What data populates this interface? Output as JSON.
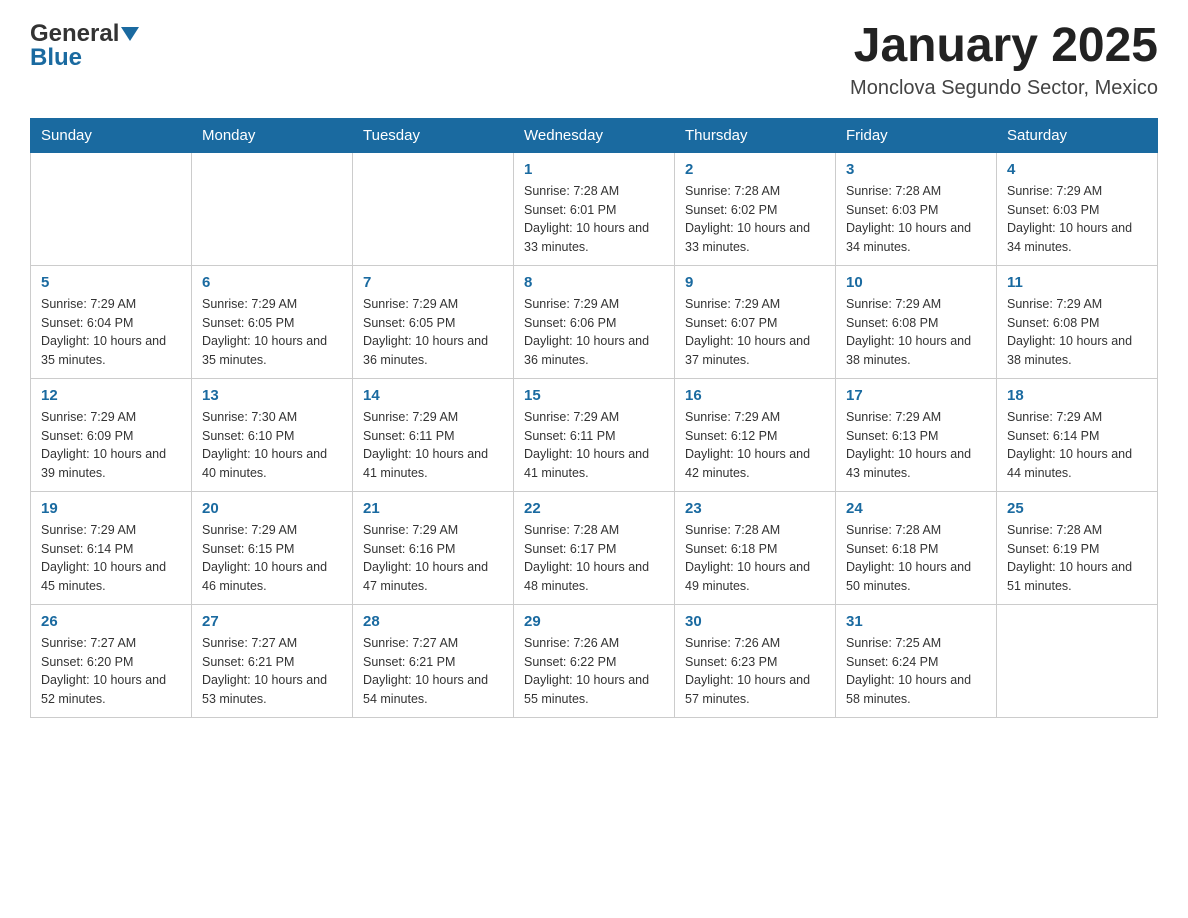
{
  "header": {
    "logo": {
      "general": "General",
      "blue": "Blue"
    },
    "title": "January 2025",
    "location": "Monclova Segundo Sector, Mexico"
  },
  "days_of_week": [
    "Sunday",
    "Monday",
    "Tuesday",
    "Wednesday",
    "Thursday",
    "Friday",
    "Saturday"
  ],
  "weeks": [
    [
      {
        "day": "",
        "info": ""
      },
      {
        "day": "",
        "info": ""
      },
      {
        "day": "",
        "info": ""
      },
      {
        "day": "1",
        "info": "Sunrise: 7:28 AM\nSunset: 6:01 PM\nDaylight: 10 hours and 33 minutes."
      },
      {
        "day": "2",
        "info": "Sunrise: 7:28 AM\nSunset: 6:02 PM\nDaylight: 10 hours and 33 minutes."
      },
      {
        "day": "3",
        "info": "Sunrise: 7:28 AM\nSunset: 6:03 PM\nDaylight: 10 hours and 34 minutes."
      },
      {
        "day": "4",
        "info": "Sunrise: 7:29 AM\nSunset: 6:03 PM\nDaylight: 10 hours and 34 minutes."
      }
    ],
    [
      {
        "day": "5",
        "info": "Sunrise: 7:29 AM\nSunset: 6:04 PM\nDaylight: 10 hours and 35 minutes."
      },
      {
        "day": "6",
        "info": "Sunrise: 7:29 AM\nSunset: 6:05 PM\nDaylight: 10 hours and 35 minutes."
      },
      {
        "day": "7",
        "info": "Sunrise: 7:29 AM\nSunset: 6:05 PM\nDaylight: 10 hours and 36 minutes."
      },
      {
        "day": "8",
        "info": "Sunrise: 7:29 AM\nSunset: 6:06 PM\nDaylight: 10 hours and 36 minutes."
      },
      {
        "day": "9",
        "info": "Sunrise: 7:29 AM\nSunset: 6:07 PM\nDaylight: 10 hours and 37 minutes."
      },
      {
        "day": "10",
        "info": "Sunrise: 7:29 AM\nSunset: 6:08 PM\nDaylight: 10 hours and 38 minutes."
      },
      {
        "day": "11",
        "info": "Sunrise: 7:29 AM\nSunset: 6:08 PM\nDaylight: 10 hours and 38 minutes."
      }
    ],
    [
      {
        "day": "12",
        "info": "Sunrise: 7:29 AM\nSunset: 6:09 PM\nDaylight: 10 hours and 39 minutes."
      },
      {
        "day": "13",
        "info": "Sunrise: 7:30 AM\nSunset: 6:10 PM\nDaylight: 10 hours and 40 minutes."
      },
      {
        "day": "14",
        "info": "Sunrise: 7:29 AM\nSunset: 6:11 PM\nDaylight: 10 hours and 41 minutes."
      },
      {
        "day": "15",
        "info": "Sunrise: 7:29 AM\nSunset: 6:11 PM\nDaylight: 10 hours and 41 minutes."
      },
      {
        "day": "16",
        "info": "Sunrise: 7:29 AM\nSunset: 6:12 PM\nDaylight: 10 hours and 42 minutes."
      },
      {
        "day": "17",
        "info": "Sunrise: 7:29 AM\nSunset: 6:13 PM\nDaylight: 10 hours and 43 minutes."
      },
      {
        "day": "18",
        "info": "Sunrise: 7:29 AM\nSunset: 6:14 PM\nDaylight: 10 hours and 44 minutes."
      }
    ],
    [
      {
        "day": "19",
        "info": "Sunrise: 7:29 AM\nSunset: 6:14 PM\nDaylight: 10 hours and 45 minutes."
      },
      {
        "day": "20",
        "info": "Sunrise: 7:29 AM\nSunset: 6:15 PM\nDaylight: 10 hours and 46 minutes."
      },
      {
        "day": "21",
        "info": "Sunrise: 7:29 AM\nSunset: 6:16 PM\nDaylight: 10 hours and 47 minutes."
      },
      {
        "day": "22",
        "info": "Sunrise: 7:28 AM\nSunset: 6:17 PM\nDaylight: 10 hours and 48 minutes."
      },
      {
        "day": "23",
        "info": "Sunrise: 7:28 AM\nSunset: 6:18 PM\nDaylight: 10 hours and 49 minutes."
      },
      {
        "day": "24",
        "info": "Sunrise: 7:28 AM\nSunset: 6:18 PM\nDaylight: 10 hours and 50 minutes."
      },
      {
        "day": "25",
        "info": "Sunrise: 7:28 AM\nSunset: 6:19 PM\nDaylight: 10 hours and 51 minutes."
      }
    ],
    [
      {
        "day": "26",
        "info": "Sunrise: 7:27 AM\nSunset: 6:20 PM\nDaylight: 10 hours and 52 minutes."
      },
      {
        "day": "27",
        "info": "Sunrise: 7:27 AM\nSunset: 6:21 PM\nDaylight: 10 hours and 53 minutes."
      },
      {
        "day": "28",
        "info": "Sunrise: 7:27 AM\nSunset: 6:21 PM\nDaylight: 10 hours and 54 minutes."
      },
      {
        "day": "29",
        "info": "Sunrise: 7:26 AM\nSunset: 6:22 PM\nDaylight: 10 hours and 55 minutes."
      },
      {
        "day": "30",
        "info": "Sunrise: 7:26 AM\nSunset: 6:23 PM\nDaylight: 10 hours and 57 minutes."
      },
      {
        "day": "31",
        "info": "Sunrise: 7:25 AM\nSunset: 6:24 PM\nDaylight: 10 hours and 58 minutes."
      },
      {
        "day": "",
        "info": ""
      }
    ]
  ]
}
